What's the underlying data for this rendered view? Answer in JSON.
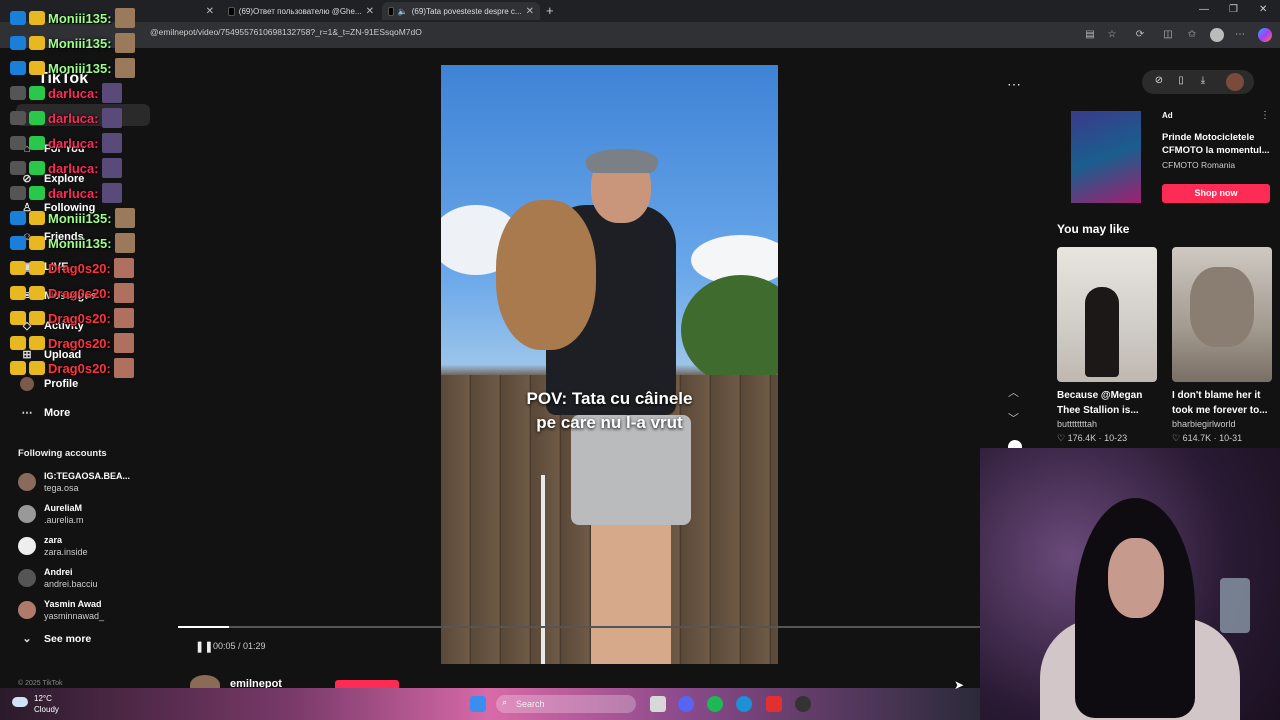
{
  "browser": {
    "tabs": [
      {
        "label": "",
        "active": false
      },
      {
        "label": "(69)Ответ пользователю @Ghe...",
        "active": false
      },
      {
        "label": "(69)Tata povesteste despre c...",
        "active": true
      }
    ],
    "url": "@emilnepot/video/7549557610698132758?_r=1&_t=ZN-91ESsqoM7dO",
    "url_prefix": "http://www.tiktok..."
  },
  "sidebar": {
    "logo": "TikTok",
    "nav": [
      {
        "label": "For You",
        "icon": "home-icon"
      },
      {
        "label": "Explore",
        "icon": "compass-icon"
      },
      {
        "label": "Following",
        "icon": "following-icon"
      },
      {
        "label": "Friends",
        "icon": "friends-icon"
      },
      {
        "label": "LIVE",
        "icon": "live-icon"
      },
      {
        "label": "Messages",
        "icon": "messages-icon"
      },
      {
        "label": "Activity",
        "icon": "activity-icon"
      },
      {
        "label": "Upload",
        "icon": "upload-icon"
      },
      {
        "label": "Profile",
        "icon": "profile-icon"
      },
      {
        "label": "More",
        "icon": "more-icon"
      }
    ],
    "following_title": "Following accounts",
    "accounts": [
      {
        "name": "IG:TEGAOSA.BEA...",
        "user": "tega.osa"
      },
      {
        "name": "AureliaM",
        "user": ".aurelia.m"
      },
      {
        "name": "zara",
        "user": "zara.inside"
      },
      {
        "name": "Andrei",
        "user": "andrei.bacciu"
      },
      {
        "name": "Yasmin Awad",
        "user": "yasminnawad_"
      }
    ],
    "see_more": "See more",
    "copyright": "© 2025 TikTok"
  },
  "chat": [
    {
      "user": "Moniii135:",
      "color": "#9cff8a"
    },
    {
      "user": "Moniii135:",
      "color": "#9cff8a"
    },
    {
      "user": "Moniii135:",
      "color": "#9cff8a"
    },
    {
      "user": "darluca:",
      "color": "#ff2a5a"
    },
    {
      "user": "darluca:",
      "color": "#ff2a5a"
    },
    {
      "user": "darluca:",
      "color": "#ff2a5a"
    },
    {
      "user": "darluca:",
      "color": "#ff2a5a"
    },
    {
      "user": "darluca:",
      "color": "#ff2a5a"
    },
    {
      "user": "Moniii135:",
      "color": "#9cff8a"
    },
    {
      "user": "Moniii135:",
      "color": "#9cff8a"
    },
    {
      "user": "Drag0s20:",
      "color": "#ff3340"
    },
    {
      "user": "Drag0s20:",
      "color": "#ff3340"
    },
    {
      "user": "Drag0s20:",
      "color": "#ff3340"
    },
    {
      "user": "Drag0s20:",
      "color": "#ff3340"
    },
    {
      "user": "Drag0s20:",
      "color": "#ff3340"
    }
  ],
  "video": {
    "caption_line1": "POV: Tata cu câinele",
    "caption_line2": "pe care nu l-a vrut",
    "time": "00:05 / 01:29",
    "progress": 0.063,
    "author": "emilnepot"
  },
  "ad": {
    "tag": "Ad",
    "title": "Prinde Motocicletele CFMOTO la momentul...",
    "brand": "CFMOTO Romania",
    "button": "Shop now"
  },
  "recommendations": {
    "title": "You may like",
    "items": [
      {
        "title": "Because @Megan Thee Stallion is...",
        "user": "buttttttttah",
        "likes": "176.4K",
        "date": "10-23"
      },
      {
        "title": "I don't blame her it took me forever to...",
        "user": "bharbiegirlworld",
        "likes": "614.7K",
        "date": "10-31"
      }
    ]
  },
  "taskbar": {
    "temp": "12°C",
    "weather": "Cloudy",
    "search": "Search"
  },
  "colors": {
    "accent": "#fe2c55",
    "background": "#121212"
  }
}
